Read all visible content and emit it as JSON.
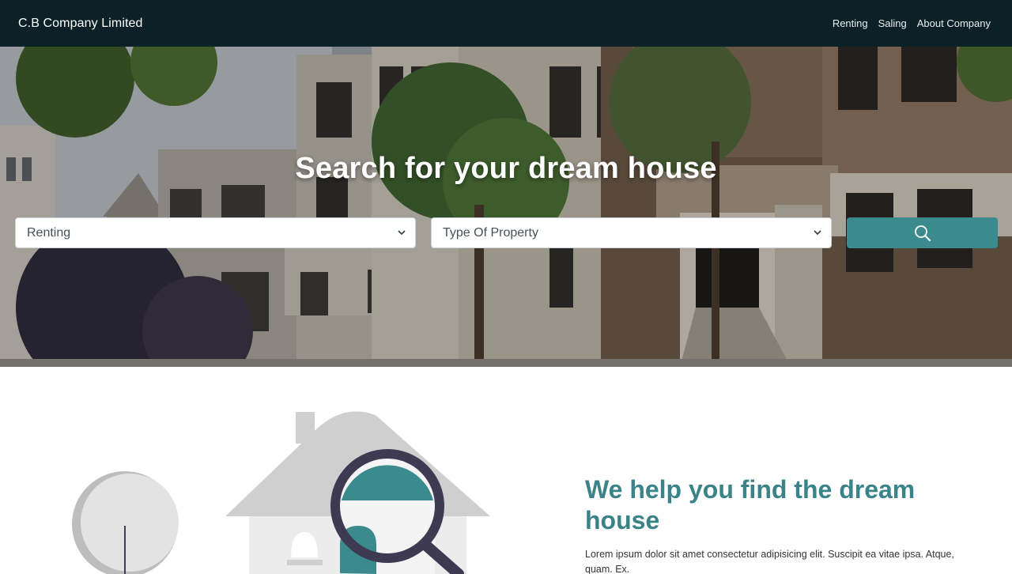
{
  "navbar": {
    "brand": "C.B Company Limited",
    "links": [
      "Renting",
      "Saling",
      "About Company"
    ]
  },
  "hero": {
    "title": "Search for your dream house",
    "transaction_select": {
      "value": "Renting"
    },
    "property_select": {
      "value": "Type Of Property"
    },
    "search_icon": "search-icon"
  },
  "feature": {
    "title": "We help you find the dream house",
    "text": "Lorem ipsum dolor sit amet consectetur adipisicing elit. Suscipit ea vitae ipsa. Atque, quam. Ex."
  },
  "colors": {
    "navbar": "#0b2127",
    "accent": "#3b8a8e",
    "heading": "#3a8389",
    "magnifier_ring": "#3d3a52"
  }
}
